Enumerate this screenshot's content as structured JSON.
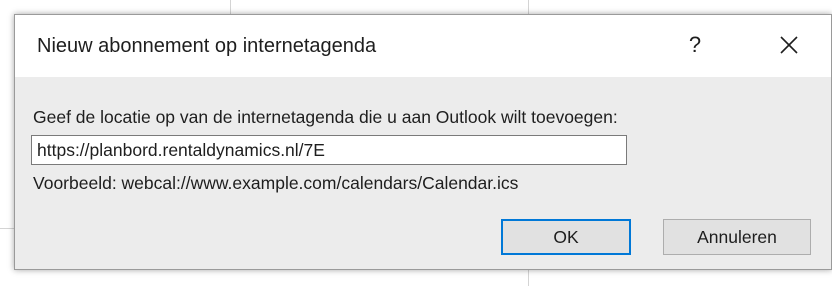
{
  "dialog": {
    "title": "Nieuw abonnement op internetagenda",
    "help_label": "?",
    "close_icon": "close-icon",
    "prompt": "Geef de locatie op van de internetagenda die u aan Outlook wilt toevoegen:",
    "url_value": "https://planbord.rentaldynamics.nl/7E                ",
    "example": "Voorbeeld: webcal://www.example.com/calendars/Calendar.ics",
    "ok_label": "OK",
    "cancel_label": "Annuleren"
  },
  "colors": {
    "dialog_background": "#ececec",
    "titlebar_background": "#ffffff",
    "default_button_border": "#0078d7"
  }
}
